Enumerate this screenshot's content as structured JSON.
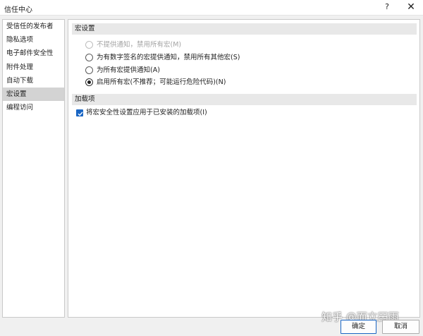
{
  "window": {
    "title": "信任中心",
    "help_label": "?",
    "close_label": "✕"
  },
  "sidebar": {
    "items": [
      {
        "label": "受信任的发布者"
      },
      {
        "label": "隐私选项"
      },
      {
        "label": "电子邮件安全性"
      },
      {
        "label": "附件处理"
      },
      {
        "label": "自动下载"
      },
      {
        "label": "宏设置"
      },
      {
        "label": "编程访问"
      }
    ],
    "selected_index": 5
  },
  "macro_settings": {
    "header": "宏设置",
    "options": [
      {
        "label": "不提供通知，禁用所有宏(M)",
        "checked": false,
        "disabled": true
      },
      {
        "label": "为有数字签名的宏提供通知，禁用所有其他宏(S)",
        "checked": false,
        "disabled": false
      },
      {
        "label": "为所有宏提供通知(A)",
        "checked": false,
        "disabled": false
      },
      {
        "label": "启用所有宏(不推荐；可能运行危险代码)(N)",
        "checked": true,
        "disabled": false
      }
    ]
  },
  "addins": {
    "header": "加载项",
    "checkbox_label": "将宏安全性设置应用于已安装的加载项(I)",
    "checked": true
  },
  "watermark": "知乎 @而立田雨",
  "buttons": {
    "ok": "确定",
    "cancel": "取消"
  },
  "colors": {
    "accent": "#1a66c4",
    "selected_item": "#d3d3d3",
    "section_header": "#e8e8e8"
  }
}
